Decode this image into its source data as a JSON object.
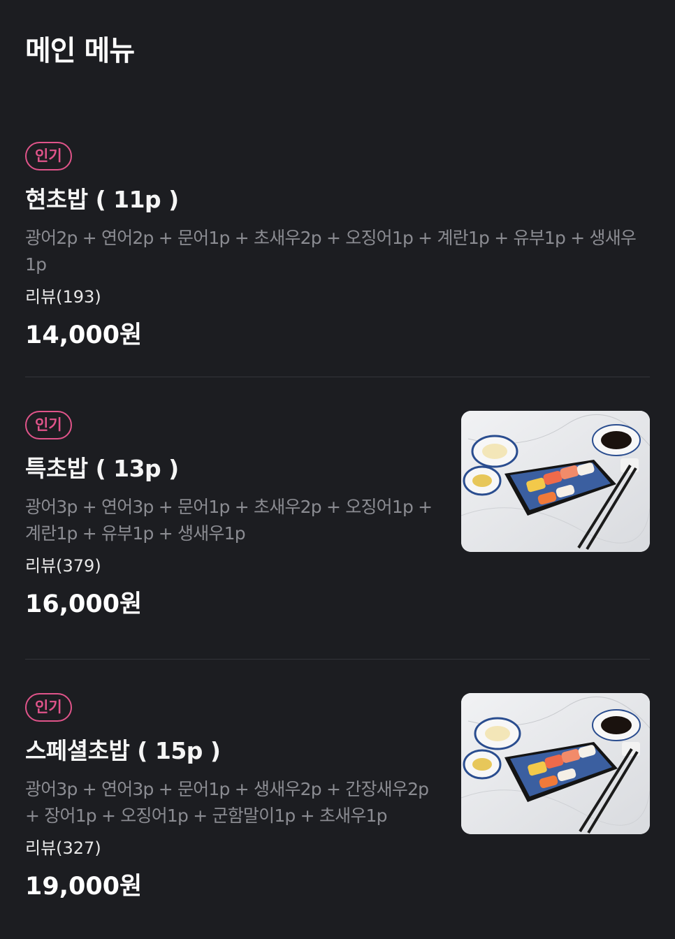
{
  "header": {
    "title": "메인 메뉴"
  },
  "menu": [
    {
      "badge": "인기",
      "name": "현초밥 ( 11p )",
      "description": "광어2p + 연어2p + 문어1p + 초새우2p + 오징어1p + 계란1p + 유부1p + 생새우1p",
      "reviews": "리뷰(193)",
      "price": "14,000원",
      "has_image": false
    },
    {
      "badge": "인기",
      "name": "특초밥 ( 13p )",
      "description": "광어3p + 연어3p + 문어1p + 초새우2p + 오징어1p + 계란1p + 유부1p + 생새우1p",
      "reviews": "리뷰(379)",
      "price": "16,000원",
      "has_image": true
    },
    {
      "badge": "인기",
      "name": "스페셜초밥 ( 15p )",
      "description": "광어3p + 연어3p + 문어1p + 생새우2p + 간장새우2p + 장어1p + 오징어1p + 군함말이1p + 초새우1p",
      "reviews": "리뷰(327)",
      "price": "19,000원",
      "has_image": true
    }
  ],
  "colors": {
    "background": "#1c1d21",
    "badge_accent": "#e0548a",
    "description_text": "#8b8c92",
    "divider": "#34353a"
  }
}
